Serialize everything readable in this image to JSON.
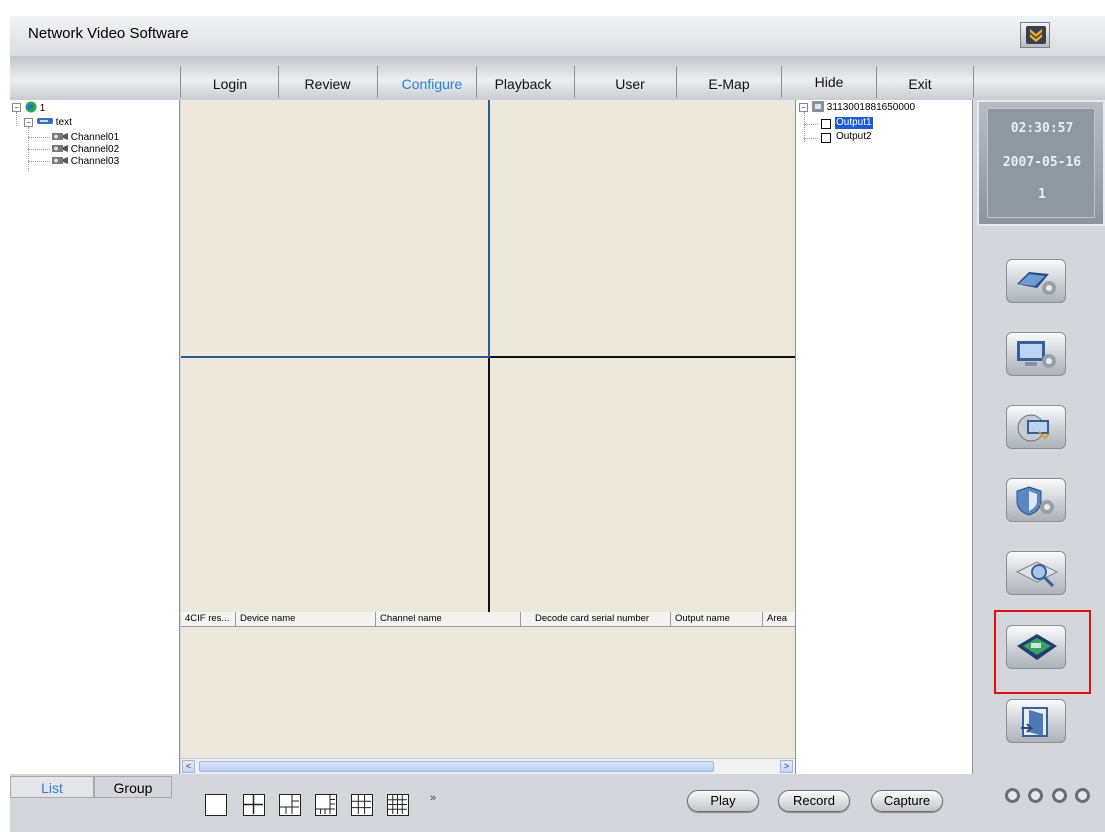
{
  "app": {
    "title": "Network Video Software"
  },
  "menu": {
    "items": [
      {
        "label": "Login"
      },
      {
        "label": "Review"
      },
      {
        "label": "Configure"
      },
      {
        "label": "Playback"
      },
      {
        "label": "User"
      },
      {
        "label": "E-Map"
      },
      {
        "label": "Hide"
      },
      {
        "label": "Exit"
      }
    ],
    "active": "Configure"
  },
  "device_tree": {
    "root_label": "1",
    "device_label": "text",
    "channels": [
      "Channel01",
      "Channel02",
      "Channel03"
    ]
  },
  "output_tree": {
    "serial": "3113001881650000",
    "outputs": [
      "Output1",
      "Output2"
    ],
    "selected": "Output1"
  },
  "clock": {
    "time": "02:30:57",
    "date": "2007-05-16",
    "day": "1"
  },
  "table": {
    "columns": [
      "4CIF res...",
      "Device name",
      "Channel name",
      "Decode card serial number",
      "Output name",
      "Area"
    ],
    "rows": []
  },
  "side_buttons": [
    {
      "icon": "device-config-icon"
    },
    {
      "icon": "monitor-config-icon"
    },
    {
      "icon": "network-config-icon"
    },
    {
      "icon": "security-config-icon"
    },
    {
      "icon": "search-config-icon"
    },
    {
      "icon": "decode-card-config-icon",
      "highlighted": true
    },
    {
      "icon": "exit-door-icon"
    }
  ],
  "bottom": {
    "tabs": [
      {
        "label": "List"
      },
      {
        "label": "Group"
      }
    ],
    "active_tab": "List",
    "more_label": "»",
    "buttons": {
      "play": "Play",
      "record": "Record",
      "capture": "Capture"
    }
  },
  "colors": {
    "accent": "#2a7fd6",
    "video_bg": "#ece9dc",
    "highlight": "#e01010",
    "selection": "#1e5ad6"
  }
}
